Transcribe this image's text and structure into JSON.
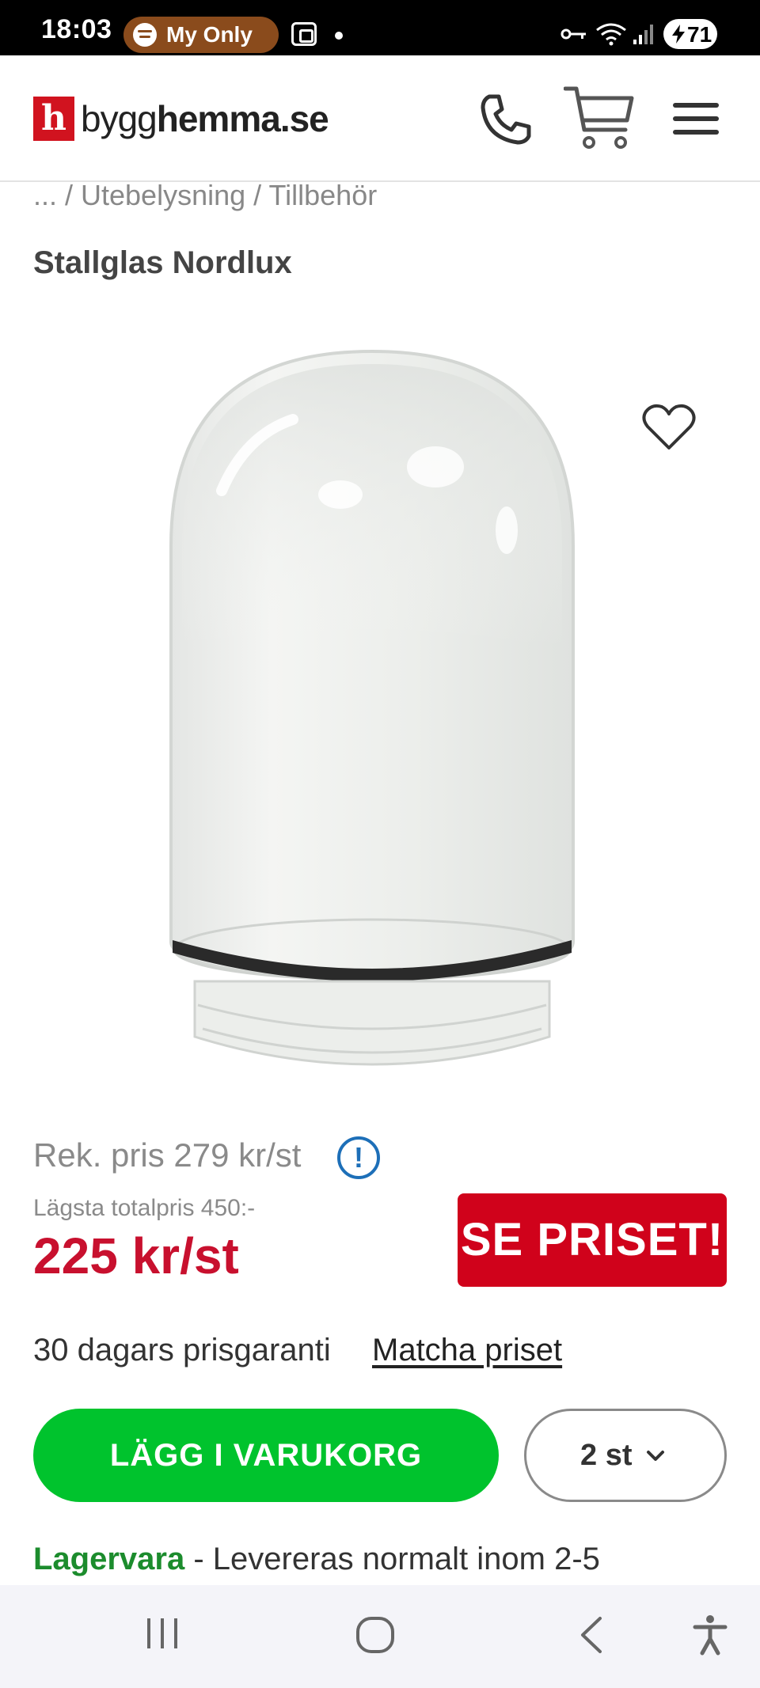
{
  "status_bar": {
    "time": "18:03",
    "media_pill_text": "My Only",
    "battery": "71"
  },
  "header": {
    "logo_letter": "h",
    "logo_text_a": "bygg",
    "logo_text_b": "hemma.se",
    "icons": [
      "phone-icon",
      "cart-icon",
      "menu-icon"
    ]
  },
  "breadcrumb": "... / Utebelysning / Tillbehör",
  "product": {
    "title": "Stallglas Nordlux",
    "rek_price": "Rek. pris 279 kr/st",
    "lowest_total": "Lägsta totalpris 450:-",
    "price": "225 kr/st",
    "promo_label": "SE PRISET!",
    "guarantee": "30 dagars prisgaranti",
    "match_link": "Matcha priset",
    "add_to_cart": "LÄGG I VARUKORG",
    "quantity": "2 st",
    "stock_status": "Lagervara",
    "delivery": " - Levereras normalt inom 2-5"
  },
  "colors": {
    "brand_red": "#d1131f",
    "price_red": "#c8102e",
    "cta_green": "#00c32d",
    "stock_green": "#1c8c2d",
    "info_blue": "#1d6fb8"
  }
}
